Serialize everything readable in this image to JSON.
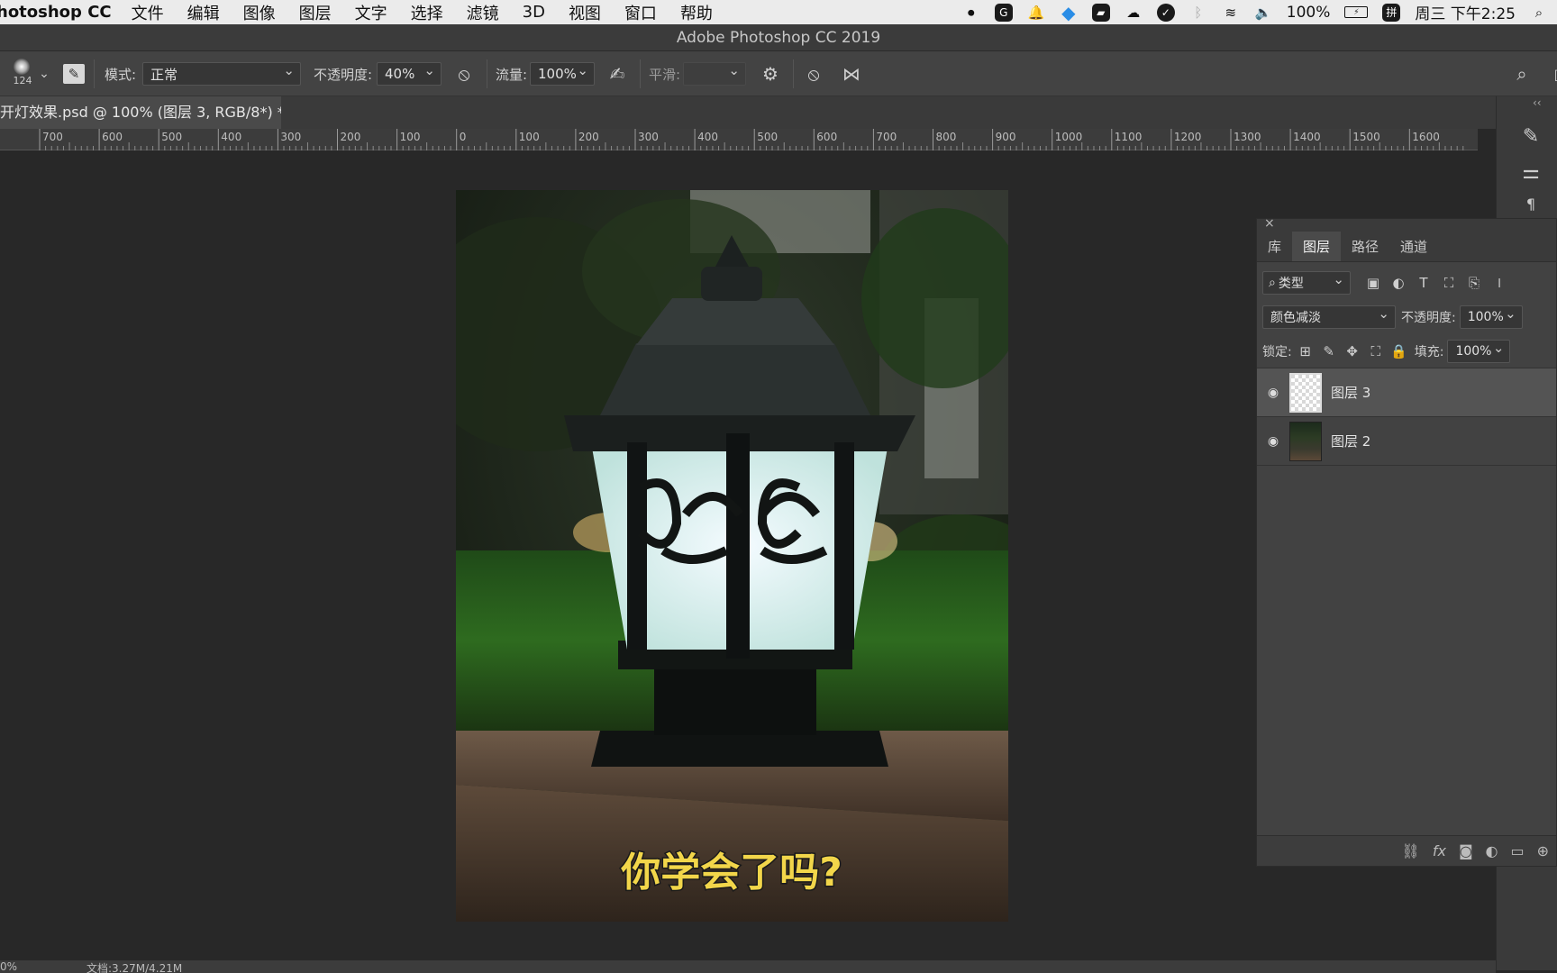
{
  "menubar": {
    "app_name": "hotoshop CC",
    "items": [
      "文件",
      "编辑",
      "图像",
      "图层",
      "文字",
      "选择",
      "滤镜",
      "3D",
      "视图",
      "窗口",
      "帮助"
    ],
    "battery": "100%",
    "datetime": "周三 下午2:25"
  },
  "window": {
    "title": "Adobe Photoshop CC 2019"
  },
  "options": {
    "brush_size": "124",
    "mode_label": "模式:",
    "mode_value": "正常",
    "opacity_label": "不透明度:",
    "opacity_value": "40%",
    "flow_label": "流量:",
    "flow_value": "100%",
    "smooth_label": "平滑:"
  },
  "document": {
    "tab_title": "开灯效果.psd @ 100% (图层 3, RGB/8*) *"
  },
  "ruler": {
    "labels": [
      "700",
      "600",
      "500",
      "400",
      "300",
      "200",
      "100",
      "0",
      "100",
      "200",
      "300",
      "400",
      "500",
      "600",
      "700",
      "800",
      "900",
      "1000",
      "1100",
      "1200",
      "1300",
      "1400",
      "1500",
      "1600"
    ]
  },
  "image": {
    "caption": "你学会了吗?"
  },
  "layers_panel": {
    "tabs": [
      "库",
      "图层",
      "路径",
      "通道"
    ],
    "active_tab": "图层",
    "filter_kind": "类型",
    "blend_mode": "颜色减淡",
    "opacity_label": "不透明度:",
    "opacity_value": "100%",
    "lock_label": "锁定:",
    "fill_label": "填充:",
    "fill_value": "100%",
    "layers": [
      {
        "name": "图层 3",
        "selected": true
      },
      {
        "name": "图层 2",
        "selected": false
      }
    ]
  },
  "statusbar": {
    "zoom": "0%",
    "doc_info": "文档:3.27M/4.21M"
  }
}
